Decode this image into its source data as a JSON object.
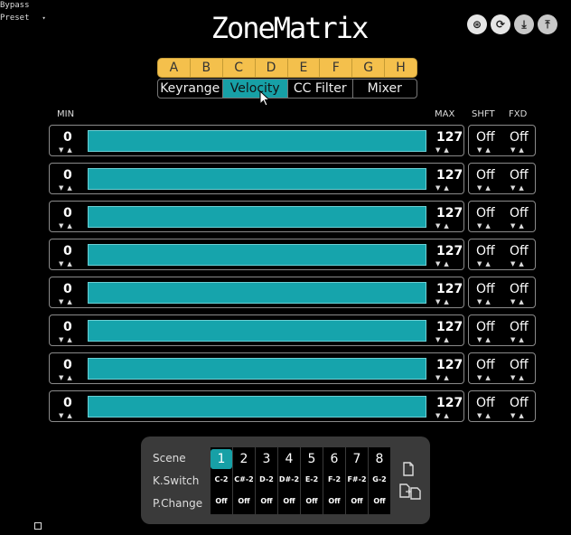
{
  "host": {
    "bypass_label": "Bypass",
    "preset_label": "Preset",
    "preset_caret": "▾"
  },
  "app": {
    "title": "ZoneMatrix"
  },
  "top_icons": [
    {
      "name": "midi-port-icon",
      "glyph": "⊛"
    },
    {
      "name": "refresh-icon",
      "glyph": "⟳"
    },
    {
      "name": "download-icon",
      "glyph": "⤓"
    },
    {
      "name": "upload-icon",
      "glyph": "⤒"
    }
  ],
  "zones": [
    "A",
    "B",
    "C",
    "D",
    "E",
    "F",
    "G",
    "H"
  ],
  "tabs": [
    {
      "label": "Keyrange",
      "active": false
    },
    {
      "label": "Velocity",
      "active": true
    },
    {
      "label": "CC Filter",
      "active": false
    },
    {
      "label": "Mixer",
      "active": false
    }
  ],
  "headers": {
    "min": "MIN",
    "max": "MAX",
    "shift": "SHFT",
    "fixed": "FXD"
  },
  "arrow_pair": "▼▲",
  "rows": [
    {
      "min": "0",
      "max": "127",
      "shift": "Off",
      "fixed": "Off"
    },
    {
      "min": "0",
      "max": "127",
      "shift": "Off",
      "fixed": "Off"
    },
    {
      "min": "0",
      "max": "127",
      "shift": "Off",
      "fixed": "Off"
    },
    {
      "min": "0",
      "max": "127",
      "shift": "Off",
      "fixed": "Off"
    },
    {
      "min": "0",
      "max": "127",
      "shift": "Off",
      "fixed": "Off"
    },
    {
      "min": "0",
      "max": "127",
      "shift": "Off",
      "fixed": "Off"
    },
    {
      "min": "0",
      "max": "127",
      "shift": "Off",
      "fixed": "Off"
    },
    {
      "min": "0",
      "max": "127",
      "shift": "Off",
      "fixed": "Off"
    }
  ],
  "scene_panel": {
    "scene_label": "Scene",
    "kswitch_label": "K.Switch",
    "pchange_label": "P.Change",
    "active_scene": 1,
    "scenes": [
      {
        "num": "1",
        "kswitch": "C-2",
        "pchange": "Off"
      },
      {
        "num": "2",
        "kswitch": "C#-2",
        "pchange": "Off"
      },
      {
        "num": "3",
        "kswitch": "D-2",
        "pchange": "Off"
      },
      {
        "num": "4",
        "kswitch": "D#-2",
        "pchange": "Off"
      },
      {
        "num": "5",
        "kswitch": "E-2",
        "pchange": "Off"
      },
      {
        "num": "6",
        "kswitch": "F-2",
        "pchange": "Off"
      },
      {
        "num": "7",
        "kswitch": "F#-2",
        "pchange": "Off"
      },
      {
        "num": "8",
        "kswitch": "G-2",
        "pchange": "Off"
      }
    ]
  }
}
